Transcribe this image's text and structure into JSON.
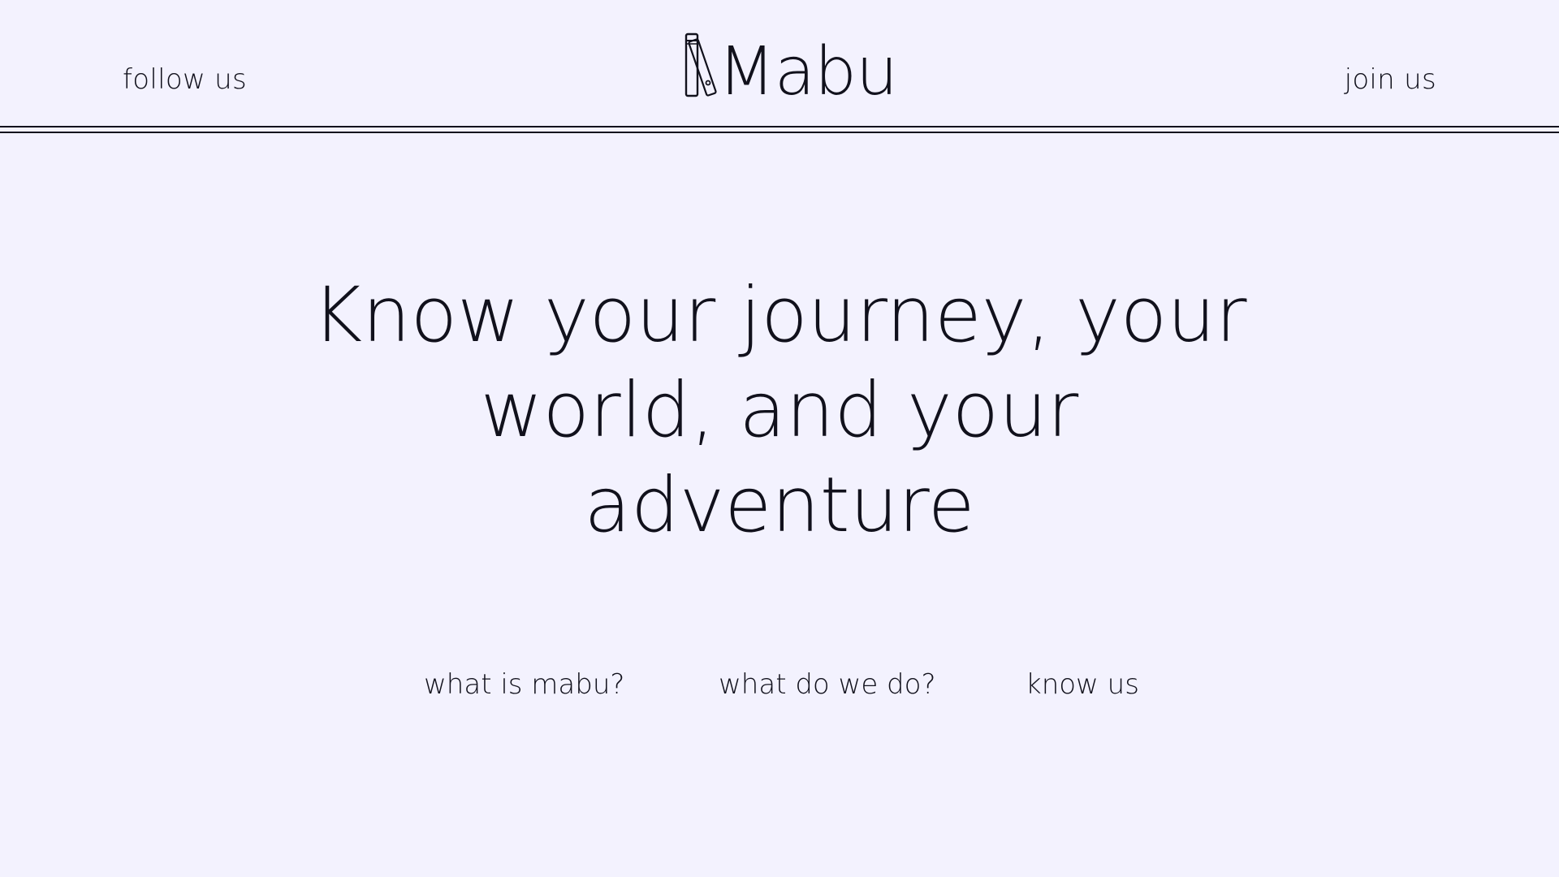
{
  "header": {
    "follow_label": "follow us",
    "logo_text": "Mabu",
    "join_label": "join us"
  },
  "hero": {
    "lines": [
      "Know your journey, your",
      "world, and your",
      "adventure"
    ]
  },
  "bottom_nav": {
    "items": [
      {
        "label": "what is mabu?"
      },
      {
        "label": "what do we do?"
      },
      {
        "label": "know us"
      }
    ]
  },
  "colors": {
    "background": "#f3f2fe",
    "text": "#11111c"
  },
  "icons": {
    "logo_icon": "books-icon"
  }
}
